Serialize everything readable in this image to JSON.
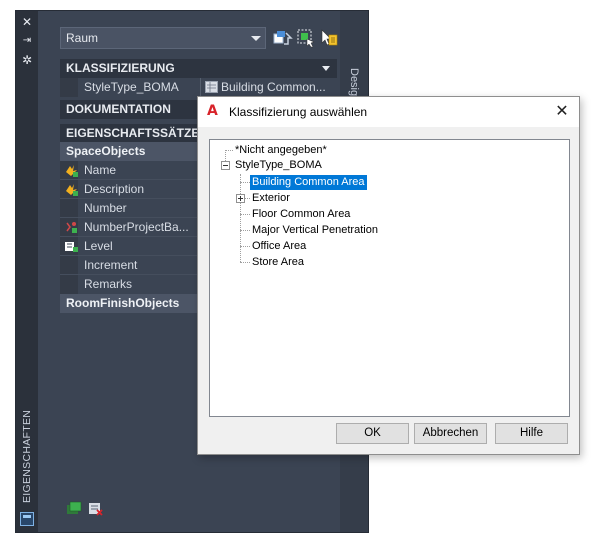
{
  "palette": {
    "vertical_title": "EIGENSCHAFTEN",
    "design_tab": "Design",
    "strip_buttons": [
      "close-icon",
      "auto-hide-icon",
      "settings-icon"
    ],
    "combo_value": "Raum",
    "toolbar_icons": [
      "quick-select-icon",
      "select-objects-icon",
      "toggle-pickadd-icon"
    ],
    "sections": {
      "klassifizierung": "KLASSIFIZIERUNG",
      "dokumentation": "DOKUMENTATION",
      "eigenschaftssaetze": "EIGENSCHAFTSSÄTZE"
    },
    "classification_row": {
      "name": "StyleType_BOMA",
      "value": "Building  Common..."
    },
    "groups": {
      "space_objects": "SpaceObjects",
      "room_finish_objects": "RoomFinishObjects"
    },
    "properties": [
      {
        "name": "Name",
        "icon": "auto-property-icon"
      },
      {
        "name": "Description",
        "icon": "auto-property-icon"
      },
      {
        "name": "Number",
        "icon": ""
      },
      {
        "name": "NumberProjectBa...",
        "icon": "formula-property-icon"
      },
      {
        "name": "Level",
        "icon": "location-property-icon"
      },
      {
        "name": "Increment",
        "icon": ""
      },
      {
        "name": "Remarks",
        "icon": ""
      }
    ],
    "bottom_icons": [
      "add-property-set-icon",
      "remove-property-set-icon"
    ]
  },
  "dialog": {
    "title": "Klassifizierung auswählen",
    "tree": {
      "root_unspecified": "*Nicht angegeben*",
      "root_boma": "StyleType_BOMA",
      "children": [
        "Building Common Area",
        "Exterior",
        "Floor Common Area",
        "Major Vertical Penetration",
        "Office Area",
        "Store Area"
      ],
      "selected_child": "Building Common Area"
    },
    "buttons": {
      "ok": "OK",
      "cancel": "Abbrechen",
      "help": "Hilfe"
    }
  },
  "colors": {
    "palette_bg": "#3b4453",
    "section_header": "#2d3440",
    "selection_blue": "#0078d7",
    "autodesk_red": "#d8232a"
  }
}
